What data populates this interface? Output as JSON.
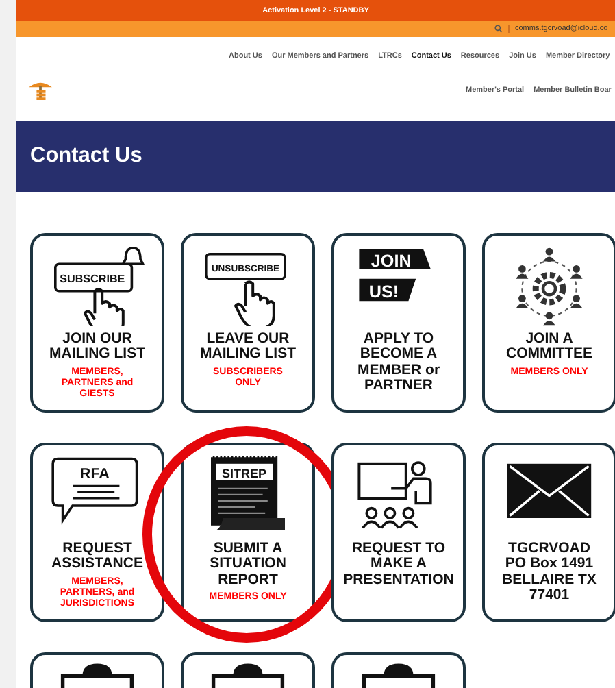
{
  "alert_bar": {
    "text": "Activation Level 2 - STANDBY"
  },
  "contact_bar": {
    "email": "comms.tgcrvoad@icloud.co"
  },
  "nav": {
    "primary": [
      {
        "label": "About Us",
        "selected": false
      },
      {
        "label": "Our Members and Partners",
        "selected": false
      },
      {
        "label": "LTRCs",
        "selected": false
      },
      {
        "label": "Contact Us",
        "selected": true
      },
      {
        "label": "Resources",
        "selected": false
      },
      {
        "label": "Join Us",
        "selected": false
      },
      {
        "label": "Member Directory",
        "selected": false
      }
    ],
    "secondary": [
      {
        "label": "Member's Portal",
        "selected": false
      },
      {
        "label": "Member Bulletin Boar",
        "selected": false
      }
    ]
  },
  "page_title": "Contact Us",
  "cards": [
    {
      "kind": "subscribe",
      "icon_text": "SUBSCRIBE",
      "title": "JOIN OUR\nMAILING LIST",
      "note": "MEMBERS,\nPARTNERS and\nGIESTS",
      "circled": false
    },
    {
      "kind": "unsubscribe",
      "icon_text": "UNSUBSCRIBE",
      "title": "LEAVE OUR\nMAILING LIST",
      "note": "SUBSCRIBERS\nONLY",
      "circled": false
    },
    {
      "kind": "join",
      "icon_text": "JOIN\nUS!",
      "title": "APPLY TO\nBECOME A\nMEMBER or\nPARTNER",
      "circled": false
    },
    {
      "kind": "network",
      "title": "JOIN A\nCOMMITTEE",
      "note": "MEMBERS ONLY",
      "circled": false
    },
    {
      "kind": "rfa",
      "icon_text": "RFA",
      "title": "REQUEST\nASSISTANCE",
      "note": "MEMBERS,\nPARTNERS, and\nJURISDICTIONS",
      "circled": false
    },
    {
      "kind": "sitrep",
      "icon_text": "SITREP",
      "title": "SUBMIT A\nSITUATION\nREPORT",
      "note": "MEMBERS ONLY",
      "circled": true
    },
    {
      "kind": "presentation",
      "title": "REQUEST TO\nMAKE A\nPRESENTATION",
      "circled": false
    },
    {
      "kind": "envelope",
      "title": "TGCRVOAD\nPO Box 1491\nBELLAIRE TX\n77401",
      "circled": false
    },
    {
      "kind": "clipboard",
      "circled": false
    },
    {
      "kind": "clipboard",
      "circled": false
    },
    {
      "kind": "clipboard",
      "circled": false
    }
  ]
}
